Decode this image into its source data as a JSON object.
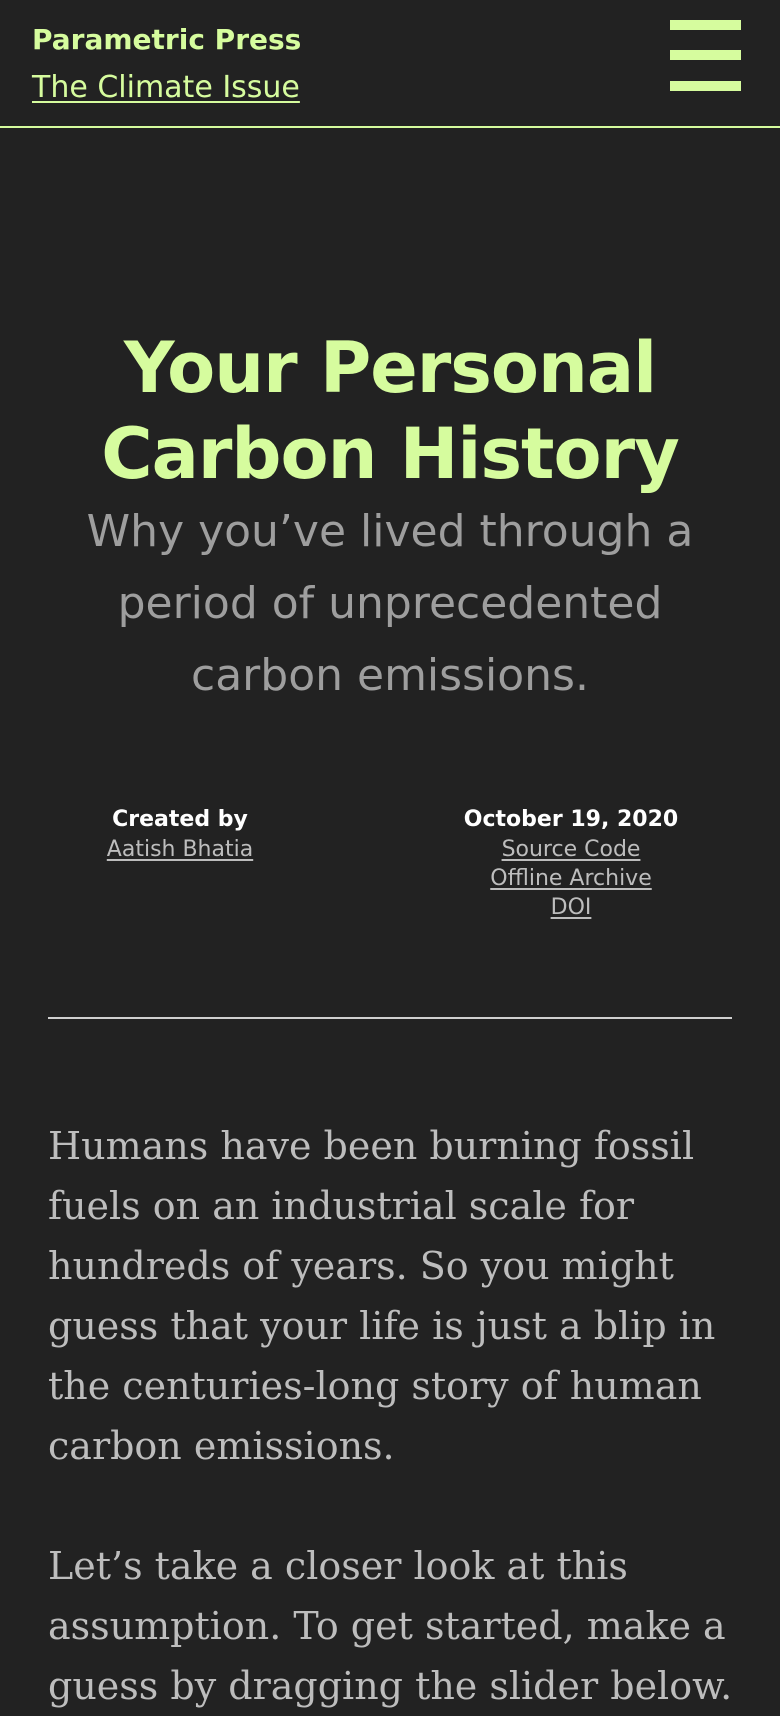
{
  "header": {
    "brand": "Parametric Press",
    "issue_link": "The Climate Issue",
    "menu_icon": "hamburger-menu-icon"
  },
  "article": {
    "title": "Your Personal Carbon History",
    "subtitle": "Why you’ve lived through a period of unprecedented carbon emissions.",
    "byline": {
      "created_by_label": "Created by",
      "author": "Aatish Bhatia",
      "date": "October 19, 2020",
      "links": {
        "source_code": "Source Code",
        "offline_archive": "Offline Archive",
        "doi": "DOI"
      }
    },
    "paragraphs": [
      "Humans have been burning fossil fuels on an industrial scale for hundreds of years. So you might guess that your life is just a blip in the centuries-long story of human carbon emissions.",
      "Let’s take a closer look at this assumption. To get started, make a guess by dragging the slider below."
    ]
  },
  "colors": {
    "background": "#222222",
    "accent": "#d6fc9e",
    "subtitle": "#9e9e9e",
    "body_text": "#bdbdbd",
    "byline_heading": "#ffffff"
  }
}
